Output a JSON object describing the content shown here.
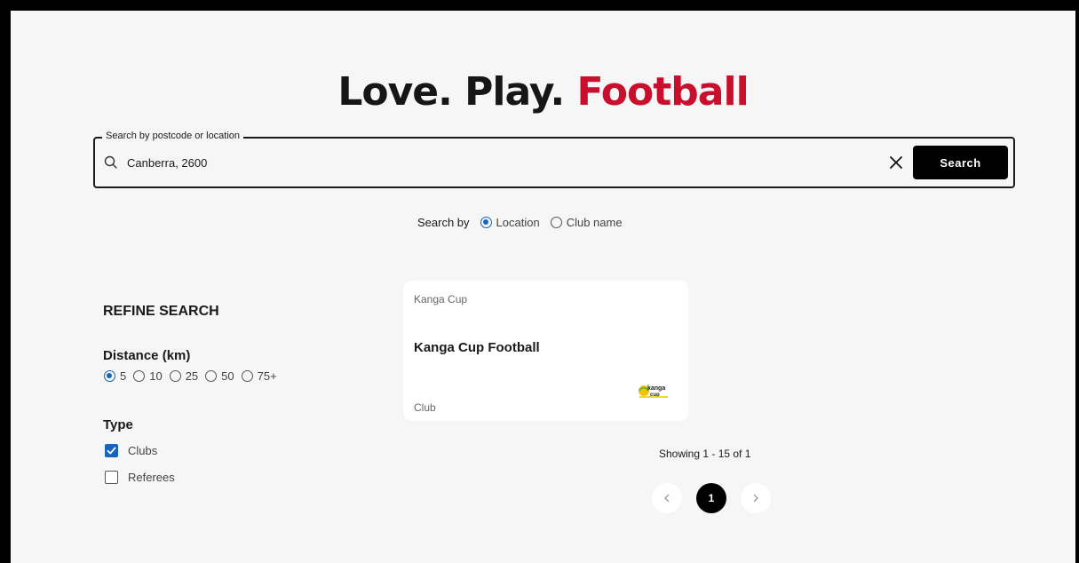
{
  "hero": {
    "title_prefix": "Love. Play.",
    "title_accent": "Football"
  },
  "search": {
    "legend": "Search by postcode or location",
    "value": "Canberra, 2600",
    "button_label": "Search",
    "search_by_label": "Search by",
    "options": [
      {
        "label": "Location",
        "selected": true
      },
      {
        "label": "Club name",
        "selected": false
      }
    ]
  },
  "refine": {
    "title": "REFINE SEARCH",
    "distance_title": "Distance (km)",
    "distance_options": [
      {
        "label": "5",
        "selected": true
      },
      {
        "label": "10",
        "selected": false
      },
      {
        "label": "25",
        "selected": false
      },
      {
        "label": "50",
        "selected": false
      },
      {
        "label": "75+",
        "selected": false
      }
    ],
    "type_title": "Type",
    "type_options": [
      {
        "label": "Clubs",
        "checked": true
      },
      {
        "label": "Referees",
        "checked": false
      }
    ]
  },
  "results": [
    {
      "tag": "Kanga Cup",
      "name": "Kanga Cup Football",
      "category": "Club",
      "logo_text": "kanga cup"
    }
  ],
  "pagination": {
    "showing": "Showing 1 - 15 of 1",
    "current_page": "1",
    "prev_icon": "chevron-left-icon",
    "next_icon": "chevron-right-icon"
  },
  "colors": {
    "accent": "#c8102e",
    "selected_control": "#1565c0",
    "button": "#000000",
    "background": "#f6f6f6"
  }
}
